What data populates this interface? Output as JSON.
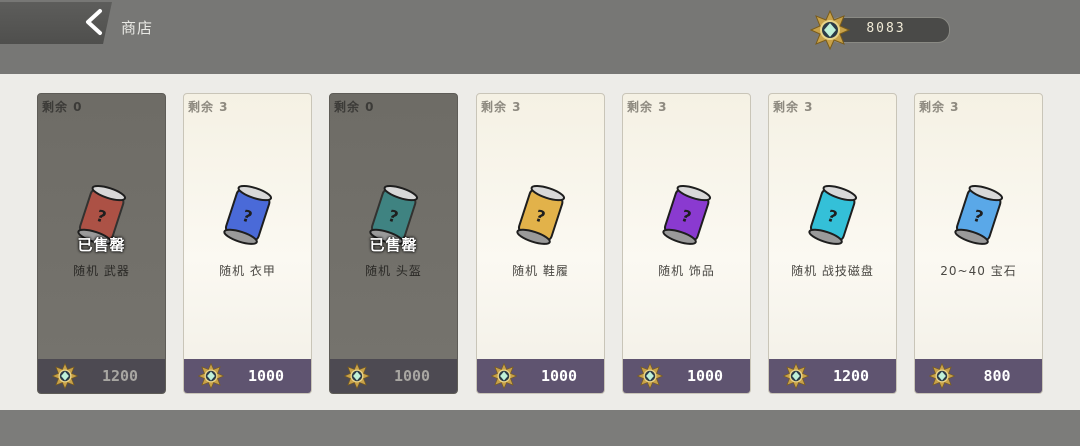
{
  "header": {
    "title": "商店",
    "currency": "8083"
  },
  "colors": {
    "price_bar": "#5f5470",
    "sold_card": "#6e6c66",
    "accent_gold": "#c8a24a"
  },
  "cards": [
    {
      "stock": "剩余 0",
      "sold_label": "已售罄",
      "name": "随机 武器",
      "price": "1200",
      "icon": "red-weapon-can-icon",
      "color": "#c0483a"
    },
    {
      "stock": "剩余 3",
      "sold_label": "",
      "name": "随机 衣甲",
      "price": "1000",
      "icon": "blue-armor-can-icon",
      "color": "#4a6ad8"
    },
    {
      "stock": "剩余 0",
      "sold_label": "已售罄",
      "name": "随机 头盔",
      "price": "1000",
      "icon": "teal-helmet-can-icon",
      "color": "#2f8a8a"
    },
    {
      "stock": "剩余 3",
      "sold_label": "",
      "name": "随机 鞋履",
      "price": "1000",
      "icon": "yellow-shoes-can-icon",
      "color": "#e2b24a"
    },
    {
      "stock": "剩余 3",
      "sold_label": "",
      "name": "随机 饰品",
      "price": "1000",
      "icon": "purple-accessory-can-icon",
      "color": "#8a3ad0"
    },
    {
      "stock": "剩余 3",
      "sold_label": "",
      "name": "随机 战技磁盘",
      "price": "1200",
      "icon": "cyan-disk-can-icon",
      "color": "#34c0d8"
    },
    {
      "stock": "剩余 3",
      "sold_label": "",
      "name": "20~40 宝石",
      "price": "800",
      "icon": "gem-can-icon",
      "color": "#5aa8e8"
    }
  ]
}
